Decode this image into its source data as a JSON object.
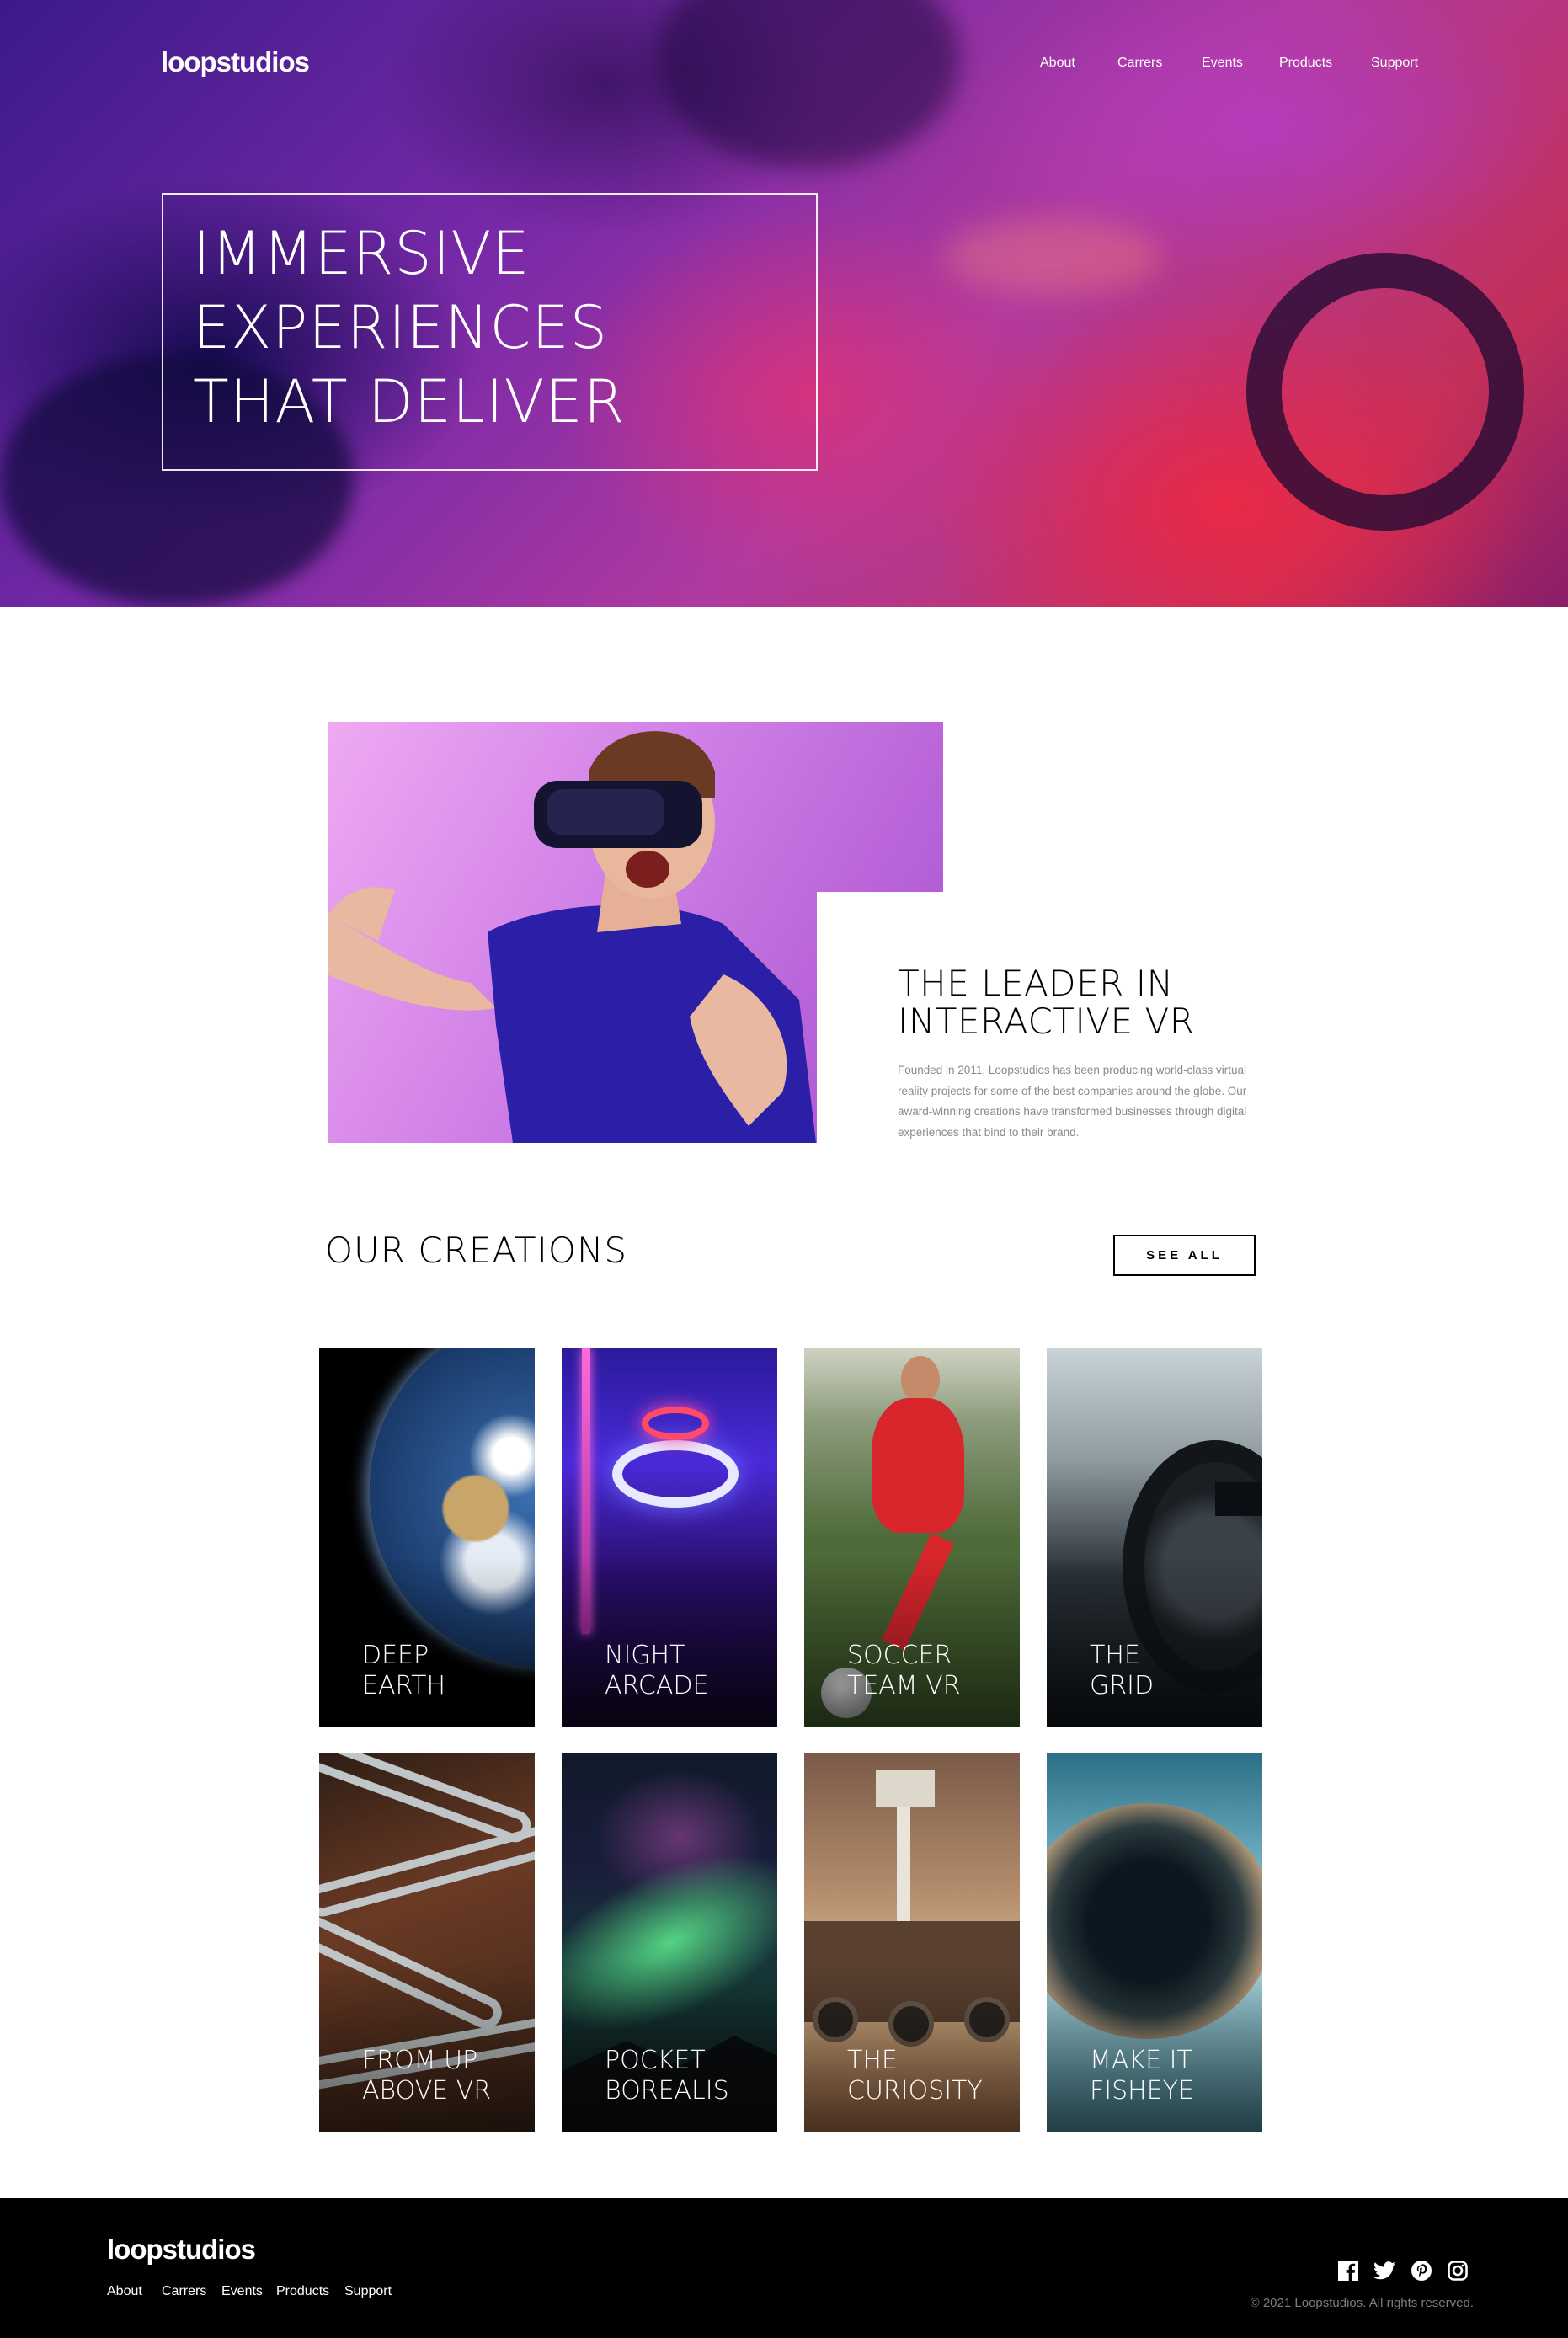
{
  "brand": {
    "logo": "loopstudios"
  },
  "nav": {
    "items": [
      {
        "label": "About"
      },
      {
        "label": "Carrers"
      },
      {
        "label": "Events"
      },
      {
        "label": "Products"
      },
      {
        "label": "Support"
      }
    ]
  },
  "hero": {
    "title_lines": [
      "IMMERSIVE",
      "EXPERIENCES",
      "THAT DELIVER"
    ]
  },
  "interactive": {
    "title_lines": [
      "THE LEADER IN",
      "INTERACTIVE VR"
    ],
    "body": "Founded in 2011, Loopstudios has been producing world-class virtual reality projects for some of the best companies around the globe. Our award-winning creations have transformed businesses through digital experiences that bind to their brand."
  },
  "creations": {
    "title": "OUR CREATIONS",
    "see_all": "SEE ALL",
    "items": [
      {
        "lines": [
          "DEEP",
          "EARTH"
        ]
      },
      {
        "lines": [
          "NIGHT",
          "ARCADE"
        ]
      },
      {
        "lines": [
          "SOCCER",
          "TEAM VR"
        ]
      },
      {
        "lines": [
          "THE",
          "GRID"
        ]
      },
      {
        "lines": [
          "FROM UP",
          "ABOVE VR"
        ]
      },
      {
        "lines": [
          "POCKET",
          "BOREALIS"
        ]
      },
      {
        "lines": [
          "THE",
          "CURIOSITY"
        ]
      },
      {
        "lines": [
          "MAKE IT",
          "FISHEYE"
        ]
      }
    ]
  },
  "footer": {
    "logo": "loopstudios",
    "nav": [
      {
        "label": "About"
      },
      {
        "label": "Carrers"
      },
      {
        "label": "Events"
      },
      {
        "label": "Products"
      },
      {
        "label": "Support"
      }
    ],
    "socials": [
      "facebook-icon",
      "twitter-icon",
      "pinterest-icon",
      "instagram-icon"
    ],
    "copyright": "© 2021 Loopstudios. All rights reserved."
  },
  "colors": {
    "hero_accent": "#7a2aa8",
    "footer_bg": "#000000",
    "body_text": "#8a8a8a"
  }
}
